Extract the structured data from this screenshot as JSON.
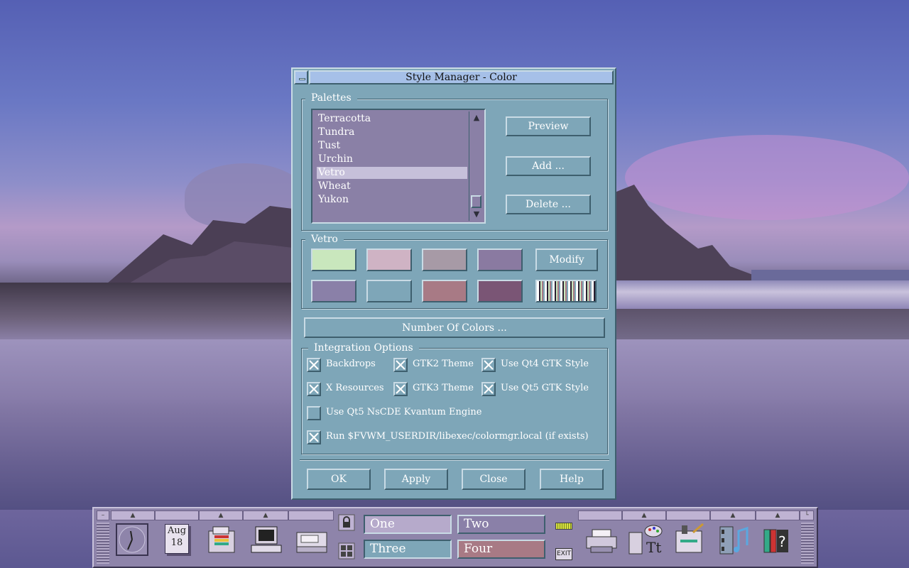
{
  "window": {
    "title": "Style Manager - Color"
  },
  "palettes": {
    "group_label": "Palettes",
    "items": [
      "Terracotta",
      "Tundra",
      "Tust",
      "Urchin",
      "Vetro",
      "Wheat",
      "Yukon"
    ],
    "selected": "Vetro",
    "buttons": {
      "preview": "Preview",
      "add": "Add ...",
      "delete": "Delete ..."
    }
  },
  "scheme": {
    "group_label": "Vetro",
    "colors": [
      "#c9e7bd",
      "#cfb3c4",
      "#a79aa6",
      "#8a7aa1",
      "#8a80a8",
      "#7ea6b8",
      "#a87a85",
      "#7a5575"
    ],
    "modify_label": "Modify"
  },
  "number_of_colors_label": "Number Of Colors ...",
  "integration": {
    "group_label": "Integration Options",
    "options": [
      {
        "label": "Backdrops",
        "checked": true
      },
      {
        "label": "GTK2 Theme",
        "checked": true
      },
      {
        "label": "Use Qt4 GTK Style",
        "checked": true
      },
      {
        "label": "X Resources",
        "checked": true
      },
      {
        "label": "GTK3 Theme",
        "checked": true
      },
      {
        "label": "Use Qt5 GTK Style",
        "checked": true
      },
      {
        "label": "Use Qt5 NsCDE Kvantum Engine",
        "checked": false
      },
      {
        "label": "Run $FVWM_USERDIR/libexec/colormgr.local (if exists)",
        "checked": true
      }
    ]
  },
  "dialog_buttons": {
    "ok": "OK",
    "apply": "Apply",
    "close": "Close",
    "help": "Help"
  },
  "panel": {
    "date": {
      "month": "Aug",
      "day": "18"
    },
    "workspaces": [
      {
        "label": "One",
        "color": "#b6aacb",
        "active": false
      },
      {
        "label": "Two",
        "color": "#8a80a8",
        "active": false
      },
      {
        "label": "Three",
        "color": "#7ea6b8",
        "active": true
      },
      {
        "label": "Four",
        "color": "#a87a85",
        "active": false
      }
    ],
    "exit_label": "EXIT",
    "icons": [
      "clock-icon",
      "calendar-icon",
      "file-manager-icon",
      "terminal-icon",
      "mail-icon",
      "lock-icon",
      "window-list-icon",
      "busy-light-icon",
      "exit-icon",
      "printer-icon",
      "style-manager-icon",
      "text-editor-icon",
      "media-player-icon",
      "help-icon"
    ]
  }
}
